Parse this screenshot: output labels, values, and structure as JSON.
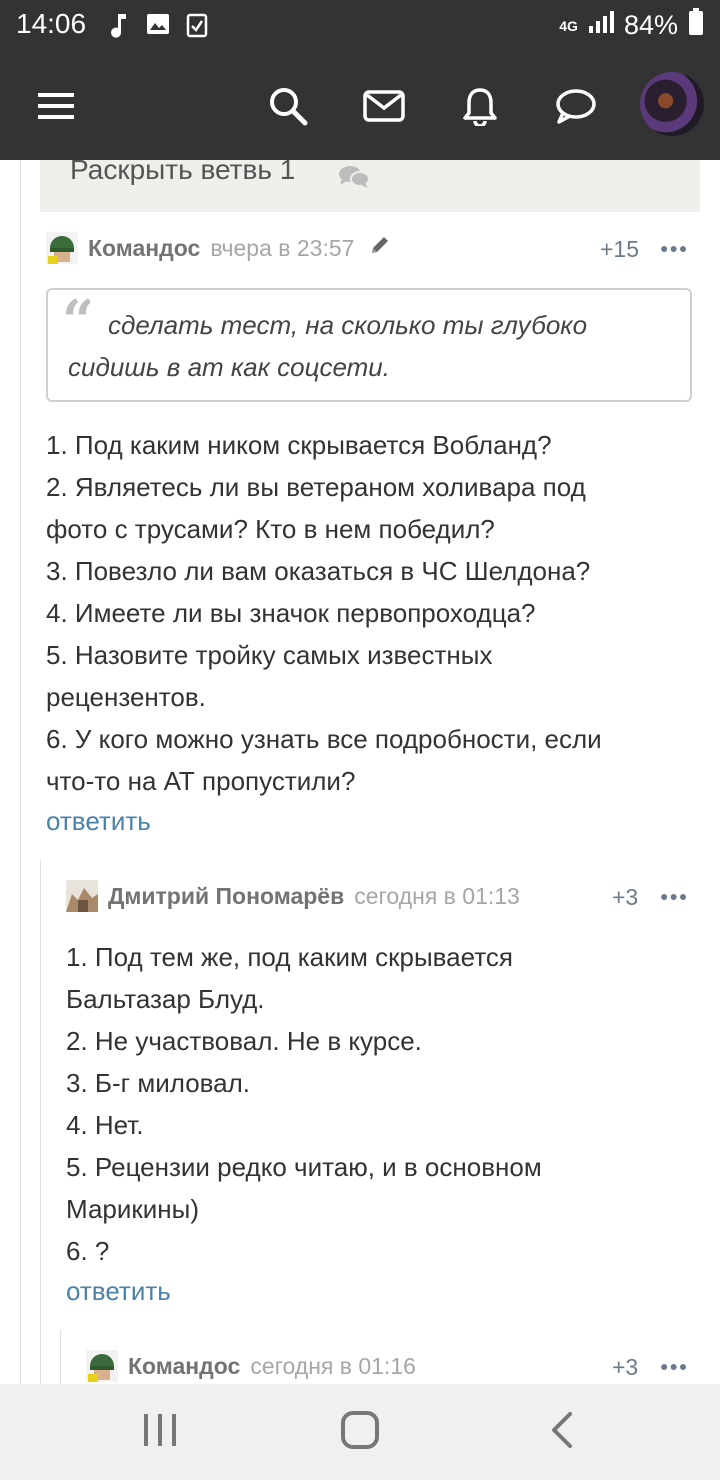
{
  "status_bar": {
    "time": "14:06",
    "network": "4G",
    "battery": "84%"
  },
  "app_bar": {
    "icons": [
      "menu-icon",
      "search-icon",
      "mail-icon",
      "bell-icon",
      "chat-icon",
      "user-avatar"
    ]
  },
  "thread": {
    "expand_label": "Раскрыть ветвь 1"
  },
  "comments": [
    {
      "author": "Командос",
      "date": "вчера в 23:57",
      "rating": "+15",
      "quote": "сделать тест, на сколько ты глубоко сидишь в ат как соцсети.",
      "lines": [
        "1. Под каким ником скрывается Вобланд?",
        "2. Являетесь ли вы ветераном холивара под",
        "фото с трусами? Кто в нем победил?",
        "3. Повезло ли вам оказаться в ЧС Шелдона?",
        "4. Имеете ли вы значок первопроходца?",
        "5. Назовите тройку самых известных",
        "рецензентов.",
        "6. У кого можно узнать все подробности, если",
        "что-то на АТ пропустили?"
      ],
      "reply_label": "ответить"
    },
    {
      "author": "Дмитрий Пономарёв",
      "date": "сегодня в 01:13",
      "rating": "+3",
      "lines": [
        "1. Под тем же, под каким скрывается",
        "Бальтазар Блуд.",
        "2. Не участвовал. Не в курсе.",
        "3. Б-г миловал.",
        "4. Нет.",
        "5. Рецензии редко читаю, и в основном",
        "Марикины)",
        "6. ?"
      ],
      "reply_label": "ответить"
    },
    {
      "author": "Командос",
      "date": "сегодня в 01:16",
      "rating": "+3"
    }
  ],
  "nav_bar": {
    "buttons": [
      "recent-apps",
      "home",
      "back"
    ]
  },
  "colors": {
    "bar": "#333333",
    "link": "#4a82a8",
    "text": "#333333",
    "rating": "#6b7b8c"
  }
}
